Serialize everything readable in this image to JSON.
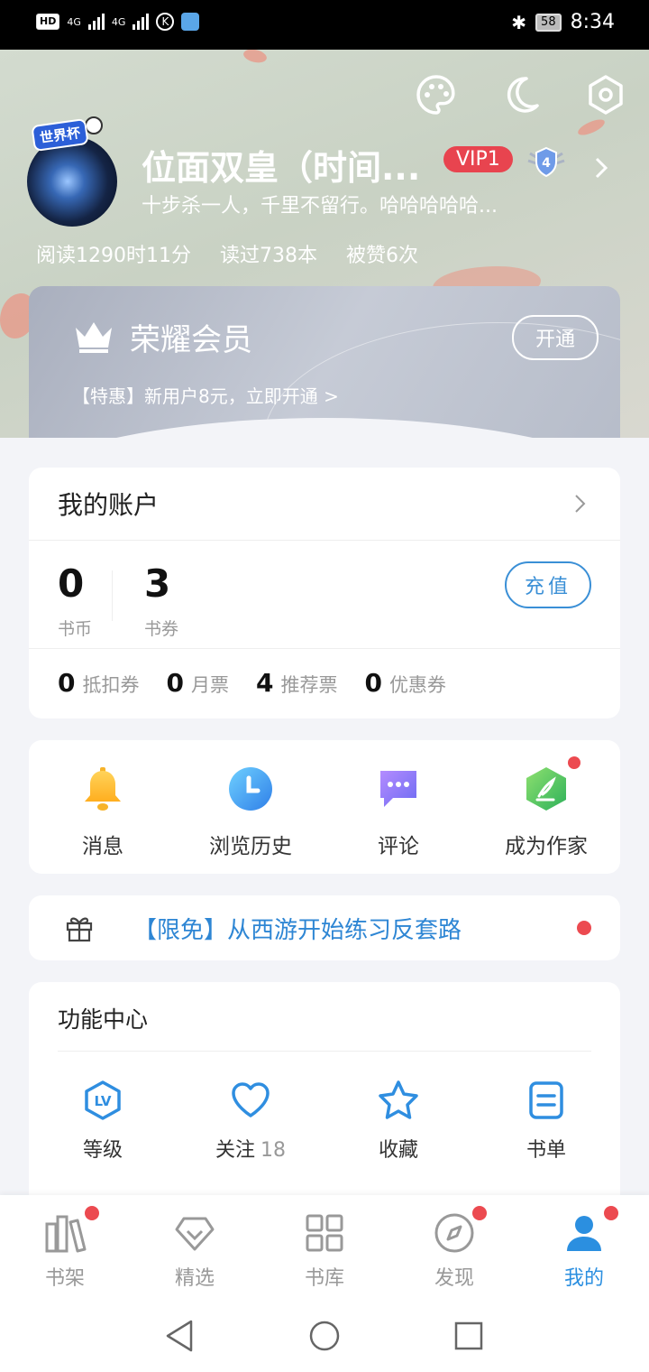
{
  "status_bar": {
    "hd": "HD",
    "net1": "4G",
    "net2": "4G",
    "battery": "58",
    "time": "8:34"
  },
  "header": {
    "avatar_badge": "世界杯",
    "username": "位面双皇（时间...",
    "vip": "VIP1",
    "level": "4",
    "motto": "十步杀一人，千里不留行。哈哈哈哈哈...",
    "stats": [
      "阅读1290时11分",
      "读过738本",
      "被赞6次"
    ],
    "icons": [
      "palette-icon",
      "moon-icon",
      "settings-hexagon-icon"
    ]
  },
  "vip_card": {
    "title": "荣耀会员",
    "button": "开通",
    "promo": "【特惠】新用户8元，立即开通 >"
  },
  "account": {
    "title": "我的账户",
    "balances": [
      {
        "value": "0",
        "label": "书币"
      },
      {
        "value": "3",
        "label": "书券"
      }
    ],
    "charge": "充值",
    "tickets": [
      {
        "value": "0",
        "label": "抵扣券"
      },
      {
        "value": "0",
        "label": "月票"
      },
      {
        "value": "4",
        "label": "推荐票"
      },
      {
        "value": "0",
        "label": "优惠券"
      }
    ]
  },
  "quick": [
    {
      "label": "消息",
      "icon": "bell-icon"
    },
    {
      "label": "浏览历史",
      "icon": "clock-icon"
    },
    {
      "label": "评论",
      "icon": "comment-icon"
    },
    {
      "label": "成为作家",
      "icon": "pen-icon"
    }
  ],
  "promo": {
    "text": "【限免】从西游开始练习反套路"
  },
  "features": {
    "title": "功能中心",
    "items": [
      {
        "label": "等级",
        "count": "",
        "icon": "level-icon"
      },
      {
        "label": "关注",
        "count": "18",
        "icon": "heart-icon"
      },
      {
        "label": "收藏",
        "count": "",
        "icon": "star-icon"
      },
      {
        "label": "书单",
        "count": "",
        "icon": "booklist-icon"
      }
    ]
  },
  "tabs": [
    {
      "label": "书架",
      "icon": "bookshelf-icon"
    },
    {
      "label": "精选",
      "icon": "diamond-icon"
    },
    {
      "label": "书库",
      "icon": "grid-icon"
    },
    {
      "label": "发现",
      "icon": "compass-icon"
    },
    {
      "label": "我的",
      "icon": "person-icon"
    }
  ],
  "colors": {
    "accent": "#2b8fe0",
    "vip_red": "#e8444f",
    "dot_red": "#ec4a50"
  }
}
